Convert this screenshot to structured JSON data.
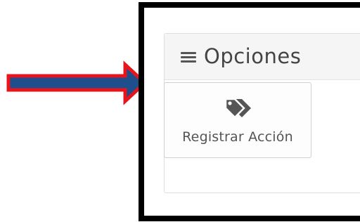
{
  "panel": {
    "title": "Opciones",
    "menu_icon": "hamburger-icon"
  },
  "action_button": {
    "label": "Registrar Acción",
    "icon": "tags-icon"
  },
  "colors": {
    "arrow_fill": "#1f4e8c",
    "arrow_stroke": "#e8141c",
    "frame": "#000000",
    "heading_bg": "#f5f5f5",
    "text": "#555555"
  }
}
